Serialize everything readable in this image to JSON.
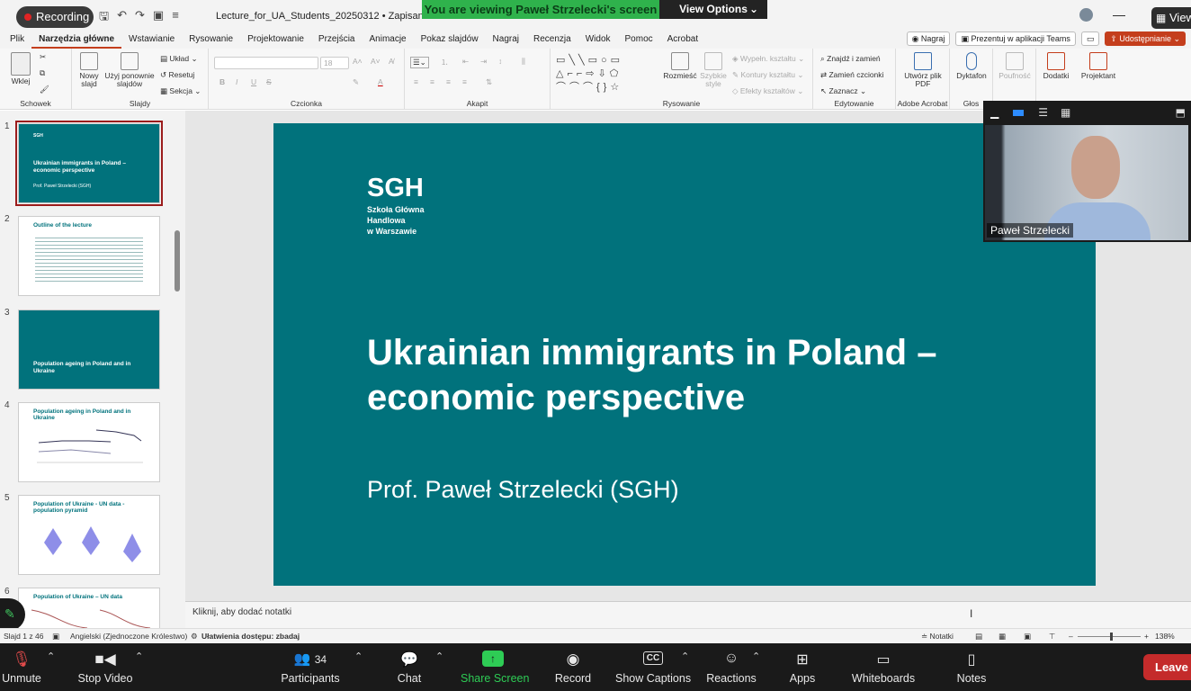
{
  "titlebar": {
    "recording_label": "Recording",
    "doc_title": "Lecture_for_UA_Students_20250312 • Zapisano ⌄",
    "share_banner": "You are viewing Paweł Strzelecki's screen",
    "view_options": "View Options",
    "view_label": "View"
  },
  "menu": {
    "items": [
      "Plik",
      "Narzędzia główne",
      "Wstawianie",
      "Rysowanie",
      "Projektowanie",
      "Przejścia",
      "Animacje",
      "Pokaz slajdów",
      "Nagraj",
      "Recenzja",
      "Widok",
      "Pomoc",
      "Acrobat"
    ],
    "record": "Nagraj",
    "present_teams": "Prezentuj w aplikacji Teams",
    "share": "Udostępnianie"
  },
  "ribbon": {
    "schowek": {
      "label": "Schowek",
      "paste": "Wklej"
    },
    "slajdy": {
      "label": "Slajdy",
      "new_slide": "Nowy slajd",
      "reuse": "Użyj ponownie slajdów",
      "layout": "Układ",
      "reset": "Resetuj",
      "section": "Sekcja"
    },
    "czcionka": {
      "label": "Czcionka",
      "size": "18"
    },
    "akapit": {
      "label": "Akapit"
    },
    "rysowanie": {
      "label": "Rysowanie",
      "arrange": "Rozmieść",
      "quick_styles": "Szybkie style",
      "fill": "Wypełn. kształtu",
      "outline": "Kontury kształtu",
      "effects": "Efekty kształtów"
    },
    "edytowanie": {
      "label": "Edytowanie",
      "find": "Znajdź i zamień",
      "replace_fonts": "Zamień czcionki",
      "select": "Zaznacz"
    },
    "acrobat": {
      "label": "Adobe Acrobat",
      "create_pdf": "Utwórz plik PDF"
    },
    "glos": {
      "label": "Głos",
      "dictate": "Dyktafon"
    },
    "sensitivity": "Poufność",
    "addins": "Dodatki",
    "designer": "Projektant"
  },
  "thumbnails": [
    {
      "num": "1",
      "text": "Ukrainian immigrants in Poland – economic perspective",
      "sub": "Prof. Paweł Strzelecki (SGH)",
      "logo": "SGH"
    },
    {
      "num": "2",
      "text": "Outline of the lecture"
    },
    {
      "num": "3",
      "text": "Population ageing in Poland and in Ukraine"
    },
    {
      "num": "4",
      "text": "Population ageing in Poland and in Ukraine"
    },
    {
      "num": "5",
      "text": "Population of Ukraine - UN data - population pyramid"
    },
    {
      "num": "6",
      "text": "Population of Ukraine – UN data"
    }
  ],
  "slide": {
    "logo": "SGH",
    "logo_sub1": "Szkoła Główna",
    "logo_sub2": "Handlowa",
    "logo_sub3": "w Warszawie",
    "title": "Ukrainian immigrants in Poland – economic perspective",
    "author": "Prof. Paweł Strzelecki (SGH)"
  },
  "notes_placeholder": "Kliknij, aby dodać notatki",
  "status": {
    "slide": "Slajd 1 z 46",
    "lang": "Angielski (Zjednoczone Królestwo)",
    "accessibility": "Ułatwienia dostępu: zbadaj",
    "notes": "Notatki",
    "zoom": "138%"
  },
  "video": {
    "name": "Paweł Strzelecki"
  },
  "zoom_toolbar": {
    "unmute": "Unmute",
    "stop_video": "Stop Video",
    "participants": "Participants",
    "participants_count": "34",
    "chat": "Chat",
    "share_screen": "Share Screen",
    "record": "Record",
    "captions": "Show Captions",
    "reactions": "Reactions",
    "apps": "Apps",
    "whiteboards": "Whiteboards",
    "notes": "Notes",
    "leave": "Leave"
  }
}
